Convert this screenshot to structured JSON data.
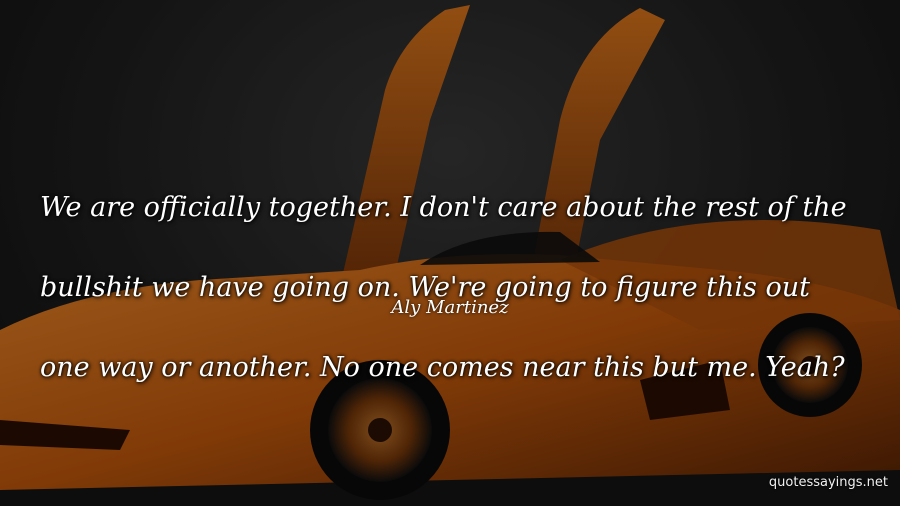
{
  "quote": {
    "lines": [
      "We are officially together. I don't care about the rest of the",
      "bullshit we have going on. We're going to figure this out",
      "one way or another. No one comes near this but me. Yeah?"
    ]
  },
  "author": "Aly Martinez",
  "watermark": "quotessayings.net",
  "colors": {
    "car_body": "#d96a12",
    "car_shadow": "#5a2405",
    "background": "#1e1e1e",
    "text": "#ffffff"
  }
}
